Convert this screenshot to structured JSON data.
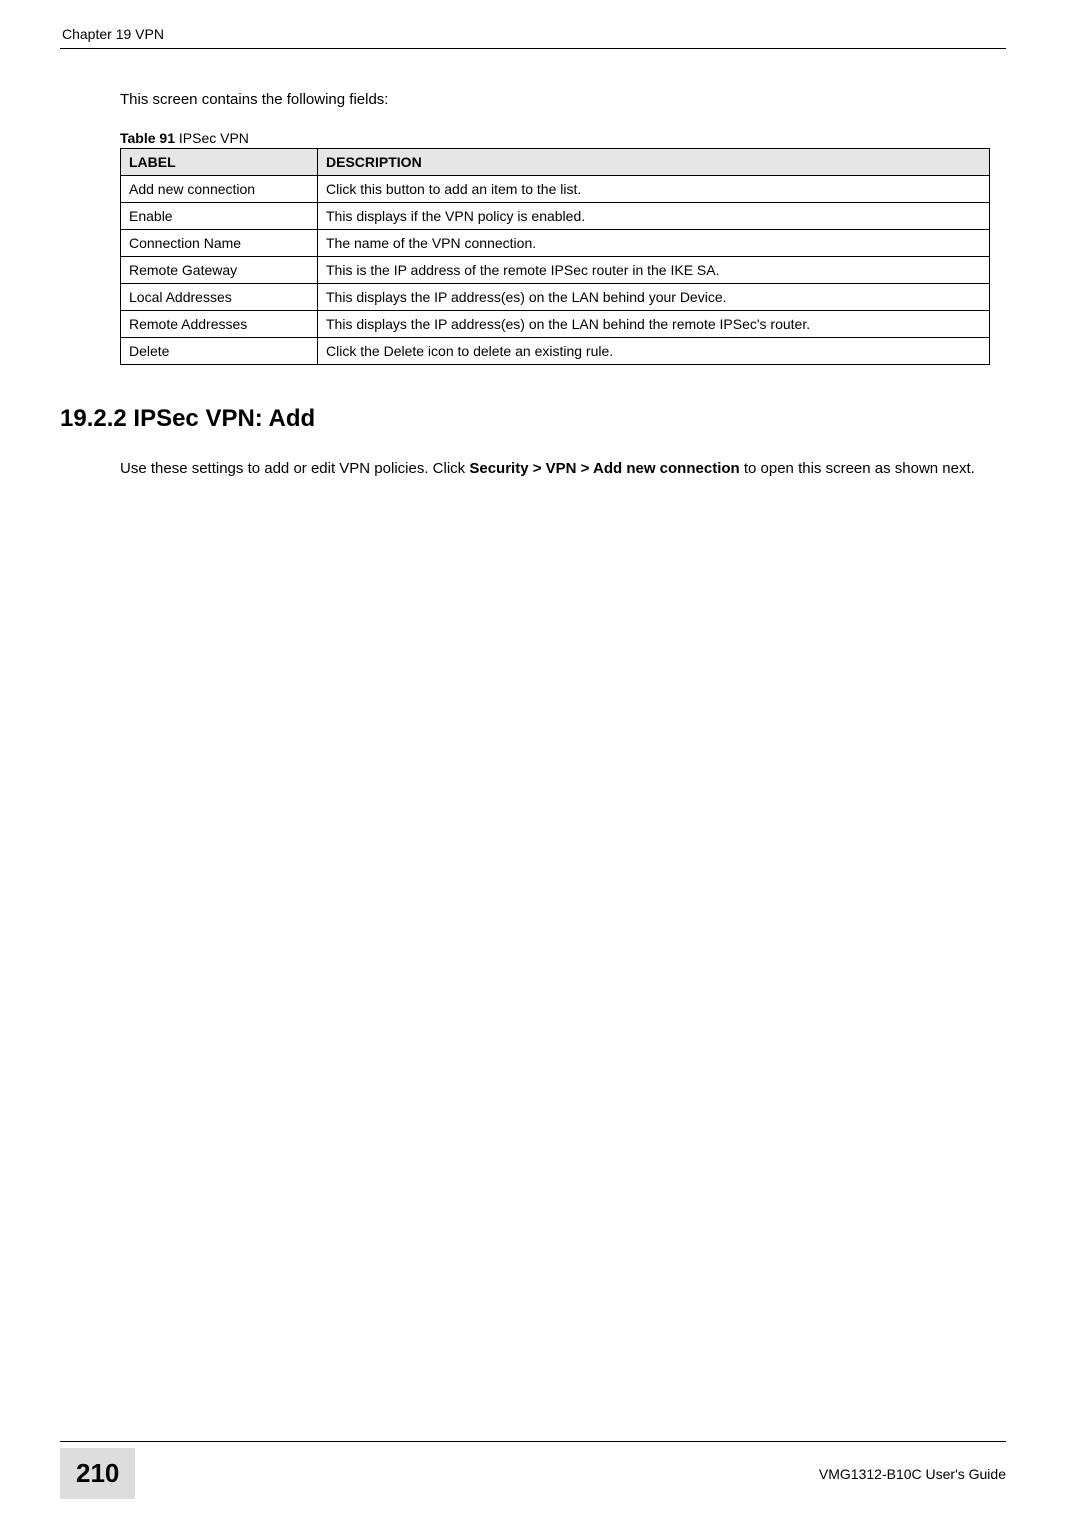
{
  "header": {
    "left": "Chapter 19 VPN",
    "right": ""
  },
  "intro_text": "This screen contains the following fields:",
  "table": {
    "caption_bold": "Table 91",
    "caption_rest": "   IPSec VPN",
    "th_label": "LABEL",
    "th_desc": "DESCRIPTION",
    "rows": [
      {
        "label": "Add new connection",
        "desc": "Click this button to add an item to the list."
      },
      {
        "label": "Enable",
        "desc": "This displays if the VPN policy is enabled."
      },
      {
        "label": "Connection Name",
        "desc": "The name of the VPN connection."
      },
      {
        "label": "Remote Gateway",
        "desc": "This is the IP address of the remote IPSec router in the IKE SA."
      },
      {
        "label": "Local Addresses",
        "desc": "This displays the IP address(es) on the LAN behind your Device."
      },
      {
        "label": "Remote Addresses",
        "desc": "This displays the IP address(es) on the LAN behind the remote IPSec's router."
      },
      {
        "label": "Delete",
        "desc_pre": "Click the ",
        "desc_bold": "Delete",
        "desc_post": " icon to delete an existing rule."
      }
    ]
  },
  "section": {
    "heading": "19.2.2  IPSec VPN: Add",
    "body_pre": "Use these settings to add or edit VPN policies.  Click ",
    "body_bold": "Security > VPN > Add new connection",
    "body_post": " to open this screen as shown next."
  },
  "footer": {
    "page_number": "210",
    "guide": "VMG1312-B10C User's Guide"
  }
}
